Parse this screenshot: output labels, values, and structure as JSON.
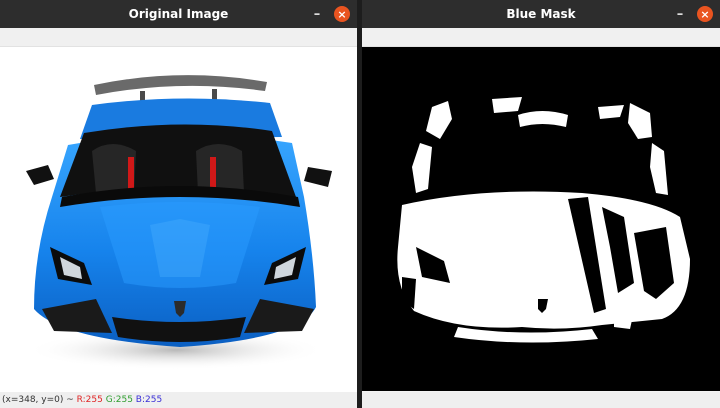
{
  "windows": {
    "left": {
      "title": "Original Image",
      "min_symbol": "–",
      "close_symbol": "×"
    },
    "right": {
      "title": "Blue Mask",
      "min_symbol": "–",
      "close_symbol": "×"
    }
  },
  "status": {
    "coords": "(x=348, y=0) ~",
    "r": "R:255",
    "g": "G:255",
    "b": "B:255"
  },
  "colors": {
    "titlebar": "#2d2d2d",
    "close_button": "#e95420",
    "car_blue": "#1e8cf0",
    "mask_background": "#000000",
    "mask_foreground": "#ffffff"
  },
  "icons": [
    "minimize-icon",
    "close-icon"
  ]
}
